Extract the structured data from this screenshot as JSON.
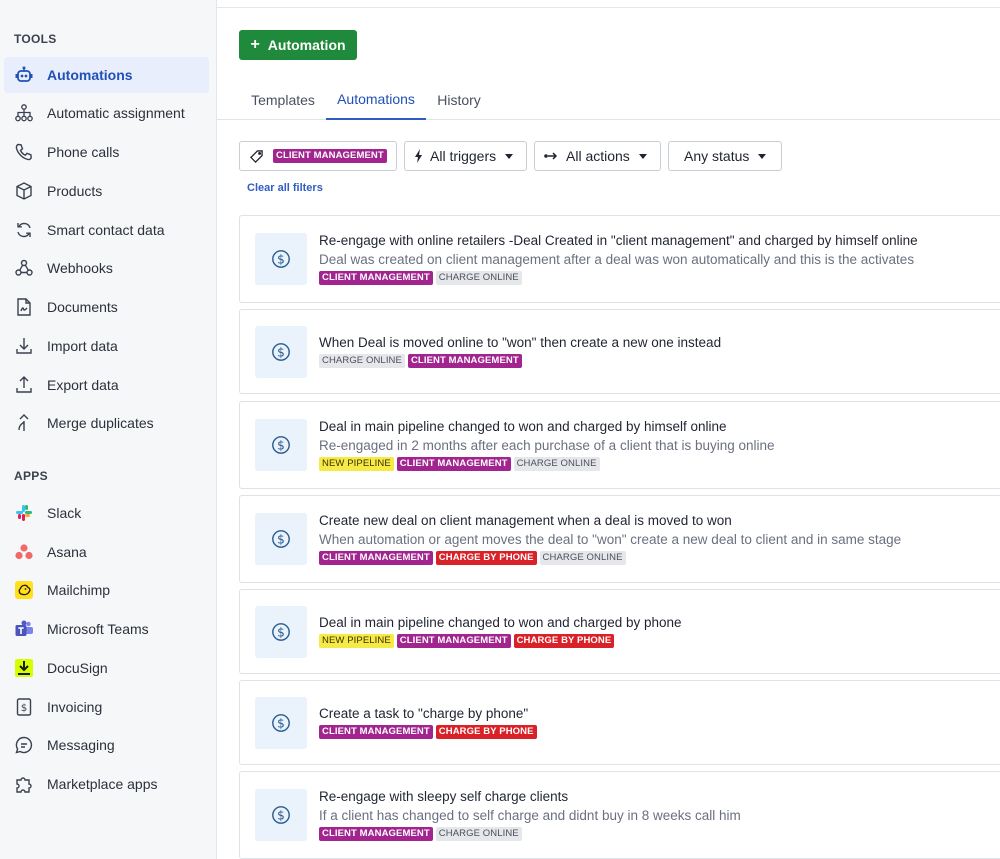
{
  "sidebar": {
    "tools_title": "TOOLS",
    "apps_title": "APPS",
    "tools": [
      {
        "label": "Automations",
        "icon": "automation-robot-icon",
        "active": true
      },
      {
        "label": "Automatic assignment",
        "icon": "assignment-tree-icon"
      },
      {
        "label": "Phone calls",
        "icon": "phone-icon"
      },
      {
        "label": "Products",
        "icon": "box-icon"
      },
      {
        "label": "Smart contact data",
        "icon": "sync-icon"
      },
      {
        "label": "Webhooks",
        "icon": "webhook-icon"
      },
      {
        "label": "Documents",
        "icon": "document-icon"
      },
      {
        "label": "Import data",
        "icon": "import-icon"
      },
      {
        "label": "Export data",
        "icon": "export-icon"
      },
      {
        "label": "Merge duplicates",
        "icon": "merge-icon"
      }
    ],
    "apps": [
      {
        "label": "Slack",
        "icon": "slack-icon"
      },
      {
        "label": "Asana",
        "icon": "asana-icon"
      },
      {
        "label": "Mailchimp",
        "icon": "mailchimp-icon"
      },
      {
        "label": "Microsoft Teams",
        "icon": "teams-icon"
      },
      {
        "label": "DocuSign",
        "icon": "docusign-icon"
      },
      {
        "label": "Invoicing",
        "icon": "invoice-icon"
      },
      {
        "label": "Messaging",
        "icon": "message-icon"
      },
      {
        "label": "Marketplace apps",
        "icon": "puzzle-icon"
      }
    ]
  },
  "header": {
    "add_button": "Automation",
    "add_icon": "+"
  },
  "tabs": [
    {
      "label": "Templates"
    },
    {
      "label": "Automations",
      "active": true
    },
    {
      "label": "History"
    }
  ],
  "filters": {
    "tag_filter": "CLIENT MANAGEMENT",
    "triggers": "All triggers",
    "actions": "All actions",
    "status": "Any status",
    "clear": "Clear all filters"
  },
  "colors": {
    "accent": "#2f5dc4",
    "add_button": "#1f8a3b",
    "client_management": "#a1248f",
    "charge_by_phone": "#d92128",
    "new_pipeline": "#f6ea46",
    "charge_online": "#e5e7ea"
  },
  "automations": [
    {
      "title": "Re-engage with online retailers -Deal Created in \"client management\" and charged by himself online",
      "description": "Deal was created on client management after a deal was won automatically and this is the activates",
      "tags": [
        {
          "label": "CLIENT MANAGEMENT",
          "kind": "cm"
        },
        {
          "label": "CHARGE ONLINE",
          "kind": "co"
        }
      ]
    },
    {
      "title": "When Deal is moved online to \"won\" then create a new one instead",
      "description": "",
      "tags": [
        {
          "label": "CHARGE ONLINE",
          "kind": "co"
        },
        {
          "label": "CLIENT MANAGEMENT",
          "kind": "cm"
        }
      ]
    },
    {
      "title": "Deal in main pipeline changed to won and charged by himself online",
      "description": "Re-engaged in 2 months after each purchase of a client that is buying online",
      "tags": [
        {
          "label": "NEW PIPELINE",
          "kind": "np"
        },
        {
          "label": "CLIENT MANAGEMENT",
          "kind": "cm"
        },
        {
          "label": "CHARGE ONLINE",
          "kind": "co"
        }
      ]
    },
    {
      "title": "Create new deal on client management when a deal is moved to won",
      "description": "When automation or agent moves the deal to \"won\" create a new deal to client and in same stage",
      "tags": [
        {
          "label": "CLIENT MANAGEMENT",
          "kind": "cm"
        },
        {
          "label": "CHARGE BY PHONE",
          "kind": "cp"
        },
        {
          "label": "CHARGE ONLINE",
          "kind": "co"
        }
      ]
    },
    {
      "title": "Deal in main pipeline changed to won and charged by phone",
      "description": "",
      "tags": [
        {
          "label": "NEW PIPELINE",
          "kind": "np"
        },
        {
          "label": "CLIENT MANAGEMENT",
          "kind": "cm"
        },
        {
          "label": "CHARGE BY PHONE",
          "kind": "cp"
        }
      ]
    },
    {
      "title": "Create a task to \"charge by phone\"",
      "description": "",
      "tags": [
        {
          "label": "CLIENT MANAGEMENT",
          "kind": "cm"
        },
        {
          "label": "CHARGE BY PHONE",
          "kind": "cp"
        }
      ]
    },
    {
      "title": "Re-engage with sleepy self charge clients",
      "description": "If a client has changed to self charge and didnt buy in 8 weeks call him",
      "tags": [
        {
          "label": "CLIENT MANAGEMENT",
          "kind": "cm"
        },
        {
          "label": "CHARGE ONLINE",
          "kind": "co"
        }
      ]
    }
  ]
}
